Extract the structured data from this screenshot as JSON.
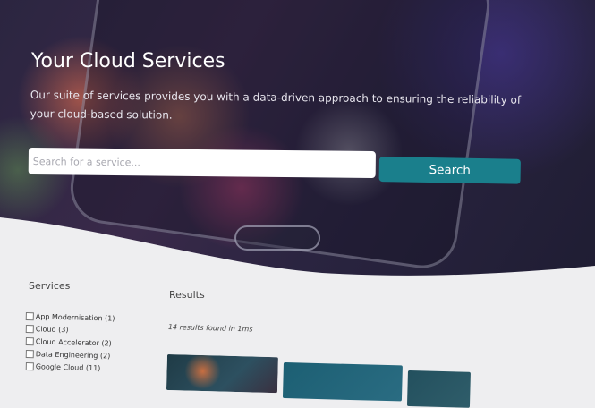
{
  "hero": {
    "title": "Your Cloud Services",
    "description": "Our suite of services provides you with a data-driven approach to ensuring the reliability of your cloud-based solution."
  },
  "search": {
    "placeholder": "Search for a service...",
    "button_label": "Search"
  },
  "filters": {
    "heading": "Services",
    "items": [
      {
        "label": "App Modernisation (1)",
        "checked": false
      },
      {
        "label": "Cloud (3)",
        "checked": false
      },
      {
        "label": "Cloud Accelerator (2)",
        "checked": false
      },
      {
        "label": "Data Engineering (2)",
        "checked": false
      },
      {
        "label": "Google Cloud (11)",
        "checked": false
      }
    ]
  },
  "results": {
    "heading": "Results",
    "count_text": "14 results found in 1ms"
  },
  "colors": {
    "accent": "#1a7f8c",
    "page_background": "#eeeef0"
  }
}
